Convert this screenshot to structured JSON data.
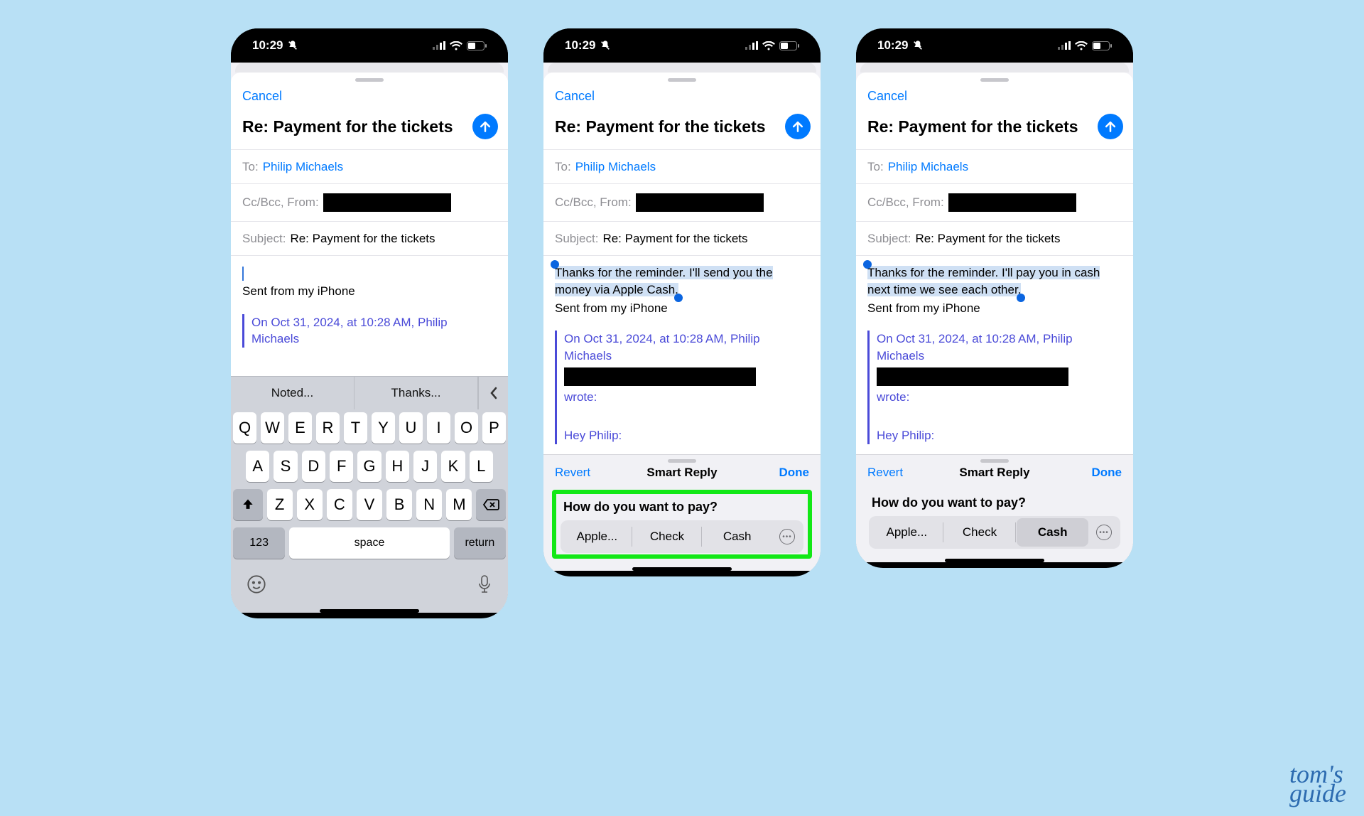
{
  "status": {
    "time": "10:29"
  },
  "compose": {
    "cancel": "Cancel",
    "title": "Re: Payment for the tickets",
    "to_label": "To:",
    "to_name": "Philip Michaels",
    "cc_label": "Cc/Bcc, From:",
    "subject_label": "Subject:",
    "subject_value": "Re: Payment for the tickets",
    "signature": "Sent from my iPhone",
    "quote_header": "On Oct 31, 2024, at 10:28 AM, Philip Michaels",
    "quote_wrote": "wrote:",
    "quote_body": "Hey Philip:"
  },
  "keyboard": {
    "suggestions": [
      "Noted...",
      "Thanks..."
    ],
    "row1": [
      "Q",
      "W",
      "E",
      "R",
      "T",
      "Y",
      "U",
      "I",
      "O",
      "P"
    ],
    "row2": [
      "A",
      "S",
      "D",
      "F",
      "G",
      "H",
      "J",
      "K",
      "L"
    ],
    "row3": [
      "Z",
      "X",
      "C",
      "V",
      "B",
      "N",
      "M"
    ],
    "num": "123",
    "space": "space",
    "return": "return"
  },
  "smart": {
    "revert": "Revert",
    "title": "Smart Reply",
    "done": "Done",
    "prompt": "How do you want to pay?",
    "options": [
      "Apple...",
      "Check",
      "Cash"
    ]
  },
  "screens": {
    "b_reply": "Thanks for the reminder. I'll send you the money via Apple Cash.",
    "c_reply": "Thanks for the reminder. I'll pay you in cash next time we see each other."
  },
  "watermark": {
    "l1": "tom's",
    "l2": "guide"
  }
}
